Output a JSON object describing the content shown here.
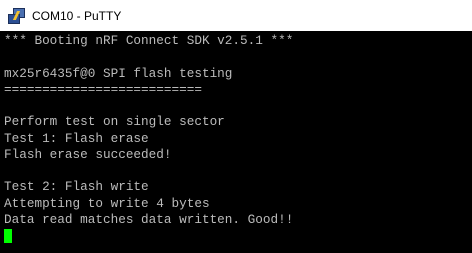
{
  "window": {
    "title": "COM10 - PuTTY",
    "icon": "putty-icon"
  },
  "terminal": {
    "lines": [
      "*** Booting nRF Connect SDK v2.5.1 ***",
      "",
      "mx25r6435f@0 SPI flash testing",
      "==========================",
      "",
      "Perform test on single sector",
      "Test 1: Flash erase",
      "Flash erase succeeded!",
      "",
      "Test 2: Flash write",
      "Attempting to write 4 bytes",
      "Data read matches data written. Good!!"
    ],
    "colors": {
      "background": "#000000",
      "foreground": "#bbbbbb",
      "cursor": "#00ff00"
    }
  }
}
